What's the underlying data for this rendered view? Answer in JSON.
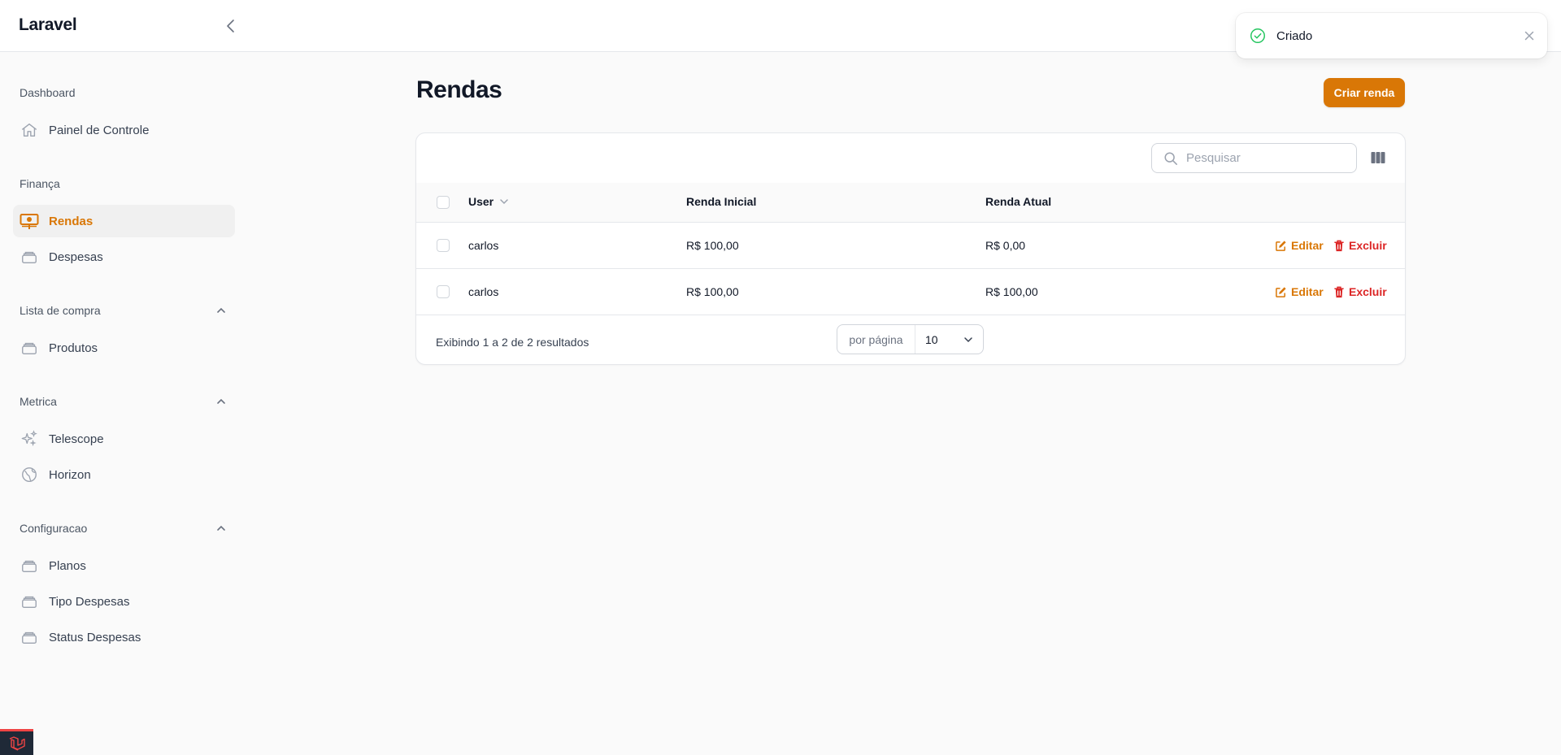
{
  "app": {
    "brand": "Laravel"
  },
  "sidebar": {
    "groups": [
      {
        "label": "Dashboard",
        "items": [
          {
            "label": "Painel de Controle",
            "icon": "home-icon"
          }
        ]
      },
      {
        "label": "Finança",
        "items": [
          {
            "label": "Rendas",
            "icon": "banknotes-icon",
            "active": true
          },
          {
            "label": "Despesas",
            "icon": "stack-icon"
          }
        ]
      },
      {
        "label": "Lista de compra",
        "items": [
          {
            "label": "Produtos",
            "icon": "stack-icon"
          }
        ]
      },
      {
        "label": "Metrica",
        "items": [
          {
            "label": "Telescope",
            "icon": "sparkles-icon"
          },
          {
            "label": "Horizon",
            "icon": "globe-icon"
          }
        ]
      },
      {
        "label": "Configuracao",
        "items": [
          {
            "label": "Planos",
            "icon": "stack-icon"
          },
          {
            "label": "Tipo Despesas",
            "icon": "stack-icon"
          },
          {
            "label": "Status Despesas",
            "icon": "stack-icon"
          }
        ]
      }
    ]
  },
  "page": {
    "title": "Rendas",
    "create_label": "Criar renda"
  },
  "table": {
    "search_placeholder": "Pesquisar",
    "columns": [
      "User",
      "Renda Inicial",
      "Renda Atual"
    ],
    "rows": [
      {
        "user": "carlos",
        "renda_inicial": "R$ 100,00",
        "renda_atual": "R$ 0,00"
      },
      {
        "user": "carlos",
        "renda_inicial": "R$ 100,00",
        "renda_atual": "R$ 100,00"
      }
    ],
    "actions": {
      "edit": "Editar",
      "delete": "Excluir"
    },
    "footer": {
      "summary": "Exibindo 1 a 2 de 2 resultados",
      "per_page_label": "por página",
      "per_page_value": "10"
    }
  },
  "toast": {
    "message": "Criado"
  },
  "colors": {
    "accent": "#d97706",
    "danger": "#dc2626",
    "success": "#22c55e"
  }
}
